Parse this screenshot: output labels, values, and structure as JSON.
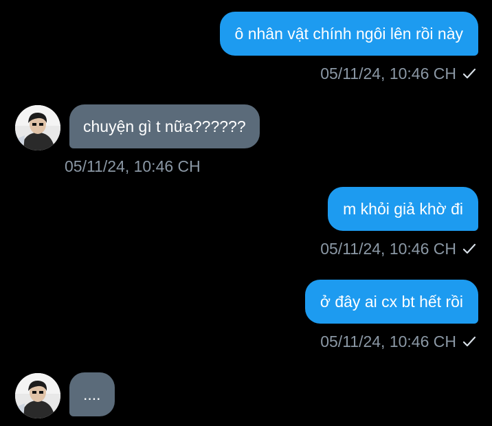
{
  "messages": [
    {
      "direction": "out",
      "text": "ô nhân vật chính ngôi lên rồi này",
      "timestamp": "05/11/24, 10:46 CH",
      "status_icon": "check-icon"
    },
    {
      "direction": "in",
      "text": "chuyện gì t nữa??????",
      "timestamp": "05/11/24, 10:46 CH",
      "avatar_icon": "avatar"
    },
    {
      "direction": "out",
      "text": "m khỏi giả khờ đi",
      "timestamp": "05/11/24, 10:46 CH",
      "status_icon": "check-icon"
    },
    {
      "direction": "out",
      "text": "ở đây ai cx bt hết rồi",
      "timestamp": "05/11/24, 10:46 CH",
      "status_icon": "check-icon"
    },
    {
      "direction": "in",
      "text": "....",
      "avatar_icon": "avatar"
    }
  ],
  "colors": {
    "background": "#000000",
    "outgoing_bubble": "#1d9bf0",
    "incoming_bubble": "#5b6b7a",
    "timestamp": "#8b98a5"
  }
}
